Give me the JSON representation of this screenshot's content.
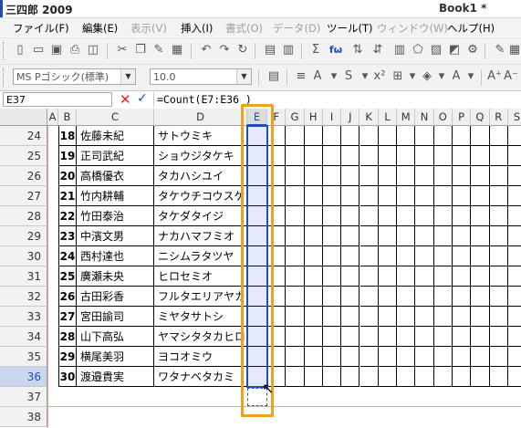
{
  "window": {
    "app_title": "三四郎 2009",
    "doc_title": "Book1 *"
  },
  "menu": [
    {
      "label": "ファイル(F)",
      "enabled": true
    },
    {
      "label": "編集(E)",
      "enabled": true
    },
    {
      "label": "表示(V)",
      "enabled": false
    },
    {
      "label": "挿入(I)",
      "enabled": true
    },
    {
      "label": "書式(O)",
      "enabled": false
    },
    {
      "label": "データ(D)",
      "enabled": false
    },
    {
      "label": "ツール(T)",
      "enabled": true
    },
    {
      "label": "ウィンドウ(W)",
      "enabled": false
    },
    {
      "label": "ヘルプ(H)",
      "enabled": true
    }
  ],
  "toolbar": {
    "font_name": "MS Pゴシック(標準)",
    "font_size": "10.0",
    "icons": [
      "new-icon",
      "open-icon",
      "save-icon",
      "print-icon",
      "preview-icon",
      "cut-icon",
      "copy-icon",
      "paste-icon",
      "format-painter-icon",
      "undo-icon",
      "redo-icon",
      "redo2-icon",
      "insert-cell-icon",
      "delete-cell-icon",
      "sum-icon",
      "function-icon",
      "sort-icon",
      "chart-icon",
      "settings-icon"
    ]
  },
  "formula_bar": {
    "name_box": "E37",
    "cancel_label": "✕",
    "confirm_label": "✓",
    "formula": "=Count(E7:E36 )"
  },
  "columns": [
    "A",
    "B",
    "C",
    "D",
    "E",
    "F",
    "G",
    "H",
    "I",
    "J",
    "K",
    "L",
    "M",
    "N",
    "O",
    "P",
    "Q",
    "R",
    "S"
  ],
  "selected_column": "E",
  "row_numbers": [
    "24",
    "25",
    "26",
    "27",
    "28",
    "29",
    "30",
    "31",
    "32",
    "33",
    "34",
    "35",
    "36",
    "37",
    "38"
  ],
  "selected_row": "36",
  "rows": [
    {
      "no": "18",
      "name": "佐藤未紀",
      "kana": "サトウミキ"
    },
    {
      "no": "19",
      "name": "正司武紀",
      "kana": "ショウジタケキ"
    },
    {
      "no": "20",
      "name": "高橋優衣",
      "kana": "タカハシユイ"
    },
    {
      "no": "21",
      "name": "竹内耕輔",
      "kana": "タケウチコウスケ"
    },
    {
      "no": "22",
      "name": "竹田泰治",
      "kana": "タケダタイジ"
    },
    {
      "no": "23",
      "name": "中濱文男",
      "kana": "ナカハマフミオ"
    },
    {
      "no": "24",
      "name": "西村達也",
      "kana": "ニシムラタツヤ"
    },
    {
      "no": "25",
      "name": "廣瀬未央",
      "kana": "ヒロセミオ"
    },
    {
      "no": "26",
      "name": "古田彩香",
      "kana": "フルタエリアヤカ"
    },
    {
      "no": "27",
      "name": "宮田諭司",
      "kana": "ミヤタサトシ"
    },
    {
      "no": "28",
      "name": "山下高弘",
      "kana": "ヤマシタタカヒロ"
    },
    {
      "no": "29",
      "name": "横尾美羽",
      "kana": "ヨコオミウ"
    },
    {
      "no": "30",
      "name": "渡邉貴実",
      "kana": "ワタナベタカミ"
    }
  ]
}
